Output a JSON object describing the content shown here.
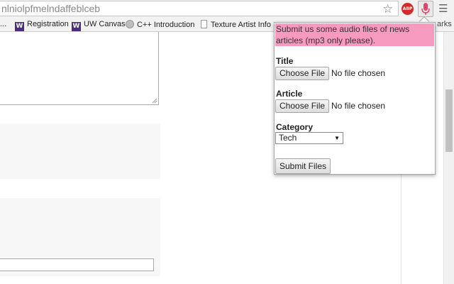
{
  "browser": {
    "url": "nlniolpfmelndaffeblceb",
    "icons": [
      "star-icon",
      "adblock-icon",
      "microphone-icon",
      "menu-icon"
    ],
    "abp_label": "ABP"
  },
  "bookmarks": {
    "items": [
      {
        "label": "Registration",
        "icon": "uw-logo-icon"
      },
      {
        "label": "UW Canvas",
        "icon": "uw-logo-icon"
      },
      {
        "label": "C++ Introduction",
        "icon": "cd-icon"
      },
      {
        "label": "Texture Artist Info",
        "icon": "page-icon"
      }
    ],
    "overflow_label": "arks",
    "leading_ellipsis": "..."
  },
  "popup": {
    "notice": "Submit us some audio files of news articles (mp3 only please).",
    "notice_color": "#f79ac0",
    "title_label": "Title",
    "title_button": "Choose File",
    "title_status": "No file chosen",
    "article_label": "Article",
    "article_button": "Choose File",
    "article_status": "No file chosen",
    "category_label": "Category",
    "category_value": "Tech",
    "submit_label": "Submit Files"
  }
}
